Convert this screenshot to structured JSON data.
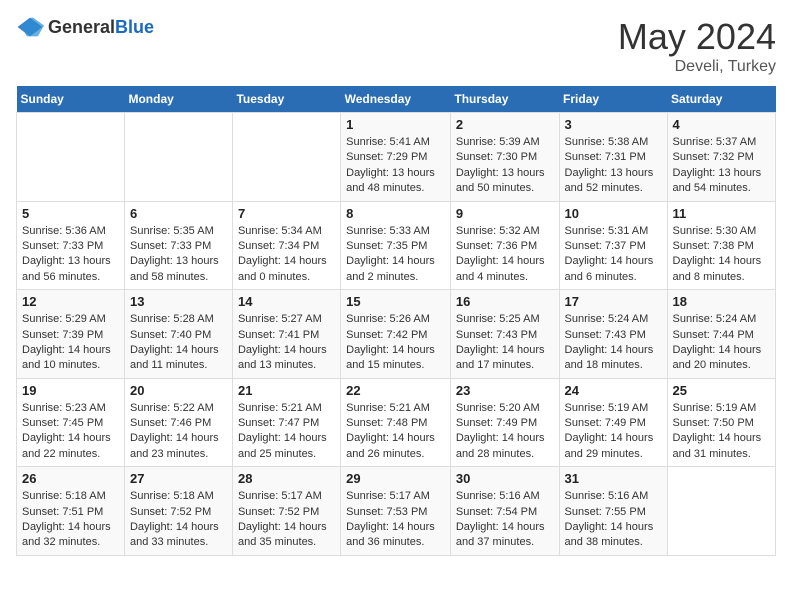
{
  "header": {
    "logo_general": "General",
    "logo_blue": "Blue",
    "title": "May 2024",
    "location": "Develi, Turkey"
  },
  "days_of_week": [
    "Sunday",
    "Monday",
    "Tuesday",
    "Wednesday",
    "Thursday",
    "Friday",
    "Saturday"
  ],
  "weeks": [
    [
      {
        "day": "",
        "info": ""
      },
      {
        "day": "",
        "info": ""
      },
      {
        "day": "",
        "info": ""
      },
      {
        "day": "1",
        "info": "Sunrise: 5:41 AM\nSunset: 7:29 PM\nDaylight: 13 hours and 48 minutes."
      },
      {
        "day": "2",
        "info": "Sunrise: 5:39 AM\nSunset: 7:30 PM\nDaylight: 13 hours and 50 minutes."
      },
      {
        "day": "3",
        "info": "Sunrise: 5:38 AM\nSunset: 7:31 PM\nDaylight: 13 hours and 52 minutes."
      },
      {
        "day": "4",
        "info": "Sunrise: 5:37 AM\nSunset: 7:32 PM\nDaylight: 13 hours and 54 minutes."
      }
    ],
    [
      {
        "day": "5",
        "info": "Sunrise: 5:36 AM\nSunset: 7:33 PM\nDaylight: 13 hours and 56 minutes."
      },
      {
        "day": "6",
        "info": "Sunrise: 5:35 AM\nSunset: 7:33 PM\nDaylight: 13 hours and 58 minutes."
      },
      {
        "day": "7",
        "info": "Sunrise: 5:34 AM\nSunset: 7:34 PM\nDaylight: 14 hours and 0 minutes."
      },
      {
        "day": "8",
        "info": "Sunrise: 5:33 AM\nSunset: 7:35 PM\nDaylight: 14 hours and 2 minutes."
      },
      {
        "day": "9",
        "info": "Sunrise: 5:32 AM\nSunset: 7:36 PM\nDaylight: 14 hours and 4 minutes."
      },
      {
        "day": "10",
        "info": "Sunrise: 5:31 AM\nSunset: 7:37 PM\nDaylight: 14 hours and 6 minutes."
      },
      {
        "day": "11",
        "info": "Sunrise: 5:30 AM\nSunset: 7:38 PM\nDaylight: 14 hours and 8 minutes."
      }
    ],
    [
      {
        "day": "12",
        "info": "Sunrise: 5:29 AM\nSunset: 7:39 PM\nDaylight: 14 hours and 10 minutes."
      },
      {
        "day": "13",
        "info": "Sunrise: 5:28 AM\nSunset: 7:40 PM\nDaylight: 14 hours and 11 minutes."
      },
      {
        "day": "14",
        "info": "Sunrise: 5:27 AM\nSunset: 7:41 PM\nDaylight: 14 hours and 13 minutes."
      },
      {
        "day": "15",
        "info": "Sunrise: 5:26 AM\nSunset: 7:42 PM\nDaylight: 14 hours and 15 minutes."
      },
      {
        "day": "16",
        "info": "Sunrise: 5:25 AM\nSunset: 7:43 PM\nDaylight: 14 hours and 17 minutes."
      },
      {
        "day": "17",
        "info": "Sunrise: 5:24 AM\nSunset: 7:43 PM\nDaylight: 14 hours and 18 minutes."
      },
      {
        "day": "18",
        "info": "Sunrise: 5:24 AM\nSunset: 7:44 PM\nDaylight: 14 hours and 20 minutes."
      }
    ],
    [
      {
        "day": "19",
        "info": "Sunrise: 5:23 AM\nSunset: 7:45 PM\nDaylight: 14 hours and 22 minutes."
      },
      {
        "day": "20",
        "info": "Sunrise: 5:22 AM\nSunset: 7:46 PM\nDaylight: 14 hours and 23 minutes."
      },
      {
        "day": "21",
        "info": "Sunrise: 5:21 AM\nSunset: 7:47 PM\nDaylight: 14 hours and 25 minutes."
      },
      {
        "day": "22",
        "info": "Sunrise: 5:21 AM\nSunset: 7:48 PM\nDaylight: 14 hours and 26 minutes."
      },
      {
        "day": "23",
        "info": "Sunrise: 5:20 AM\nSunset: 7:49 PM\nDaylight: 14 hours and 28 minutes."
      },
      {
        "day": "24",
        "info": "Sunrise: 5:19 AM\nSunset: 7:49 PM\nDaylight: 14 hours and 29 minutes."
      },
      {
        "day": "25",
        "info": "Sunrise: 5:19 AM\nSunset: 7:50 PM\nDaylight: 14 hours and 31 minutes."
      }
    ],
    [
      {
        "day": "26",
        "info": "Sunrise: 5:18 AM\nSunset: 7:51 PM\nDaylight: 14 hours and 32 minutes."
      },
      {
        "day": "27",
        "info": "Sunrise: 5:18 AM\nSunset: 7:52 PM\nDaylight: 14 hours and 33 minutes."
      },
      {
        "day": "28",
        "info": "Sunrise: 5:17 AM\nSunset: 7:52 PM\nDaylight: 14 hours and 35 minutes."
      },
      {
        "day": "29",
        "info": "Sunrise: 5:17 AM\nSunset: 7:53 PM\nDaylight: 14 hours and 36 minutes."
      },
      {
        "day": "30",
        "info": "Sunrise: 5:16 AM\nSunset: 7:54 PM\nDaylight: 14 hours and 37 minutes."
      },
      {
        "day": "31",
        "info": "Sunrise: 5:16 AM\nSunset: 7:55 PM\nDaylight: 14 hours and 38 minutes."
      },
      {
        "day": "",
        "info": ""
      }
    ]
  ]
}
